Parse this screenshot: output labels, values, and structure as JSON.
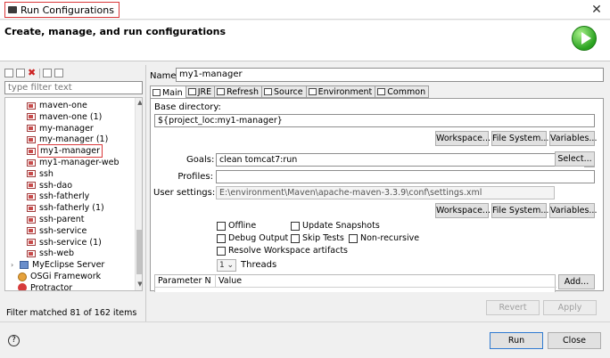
{
  "window": {
    "title": "Run Configurations",
    "close_glyph": "✕"
  },
  "header": {
    "text": "Create, manage, and run configurations",
    "icon": "run-icon"
  },
  "left": {
    "toolbar_icons": [
      "new-config-icon",
      "duplicate-icon",
      "delete-icon",
      "filter-icon",
      "collapse-icon"
    ],
    "toolbar_delete_glyph": "✖",
    "filter_placeholder": "type filter text",
    "tree": [
      {
        "label": "maven-one",
        "type": "maven"
      },
      {
        "label": "maven-one (1)",
        "type": "maven"
      },
      {
        "label": "my-manager",
        "type": "maven"
      },
      {
        "label": "my-manager (1)",
        "type": "maven"
      },
      {
        "label": "my1-manager",
        "type": "maven",
        "selected": true
      },
      {
        "label": "my1-manager-web",
        "type": "maven"
      },
      {
        "label": "ssh",
        "type": "maven"
      },
      {
        "label": "ssh-dao",
        "type": "maven"
      },
      {
        "label": "ssh-fatherly",
        "type": "maven"
      },
      {
        "label": "ssh-fatherly (1)",
        "type": "maven"
      },
      {
        "label": "ssh-parent",
        "type": "maven"
      },
      {
        "label": "ssh-service",
        "type": "maven"
      },
      {
        "label": "ssh-service (1)",
        "type": "maven"
      },
      {
        "label": "ssh-web",
        "type": "maven"
      },
      {
        "label": "MyEclipse Server",
        "type": "server",
        "twisty": "›"
      },
      {
        "label": "OSGi Framework",
        "type": "osgi"
      },
      {
        "label": "Protractor",
        "type": "protractor"
      }
    ],
    "scroll_up_glyph": "▲",
    "scroll_down_glyph": "▼",
    "status": "Filter matched 81 of 162 items"
  },
  "main": {
    "name_label": "Name:",
    "name_value": "my1-manager",
    "tabs": [
      {
        "label": "Main",
        "active": true
      },
      {
        "label": "JRE"
      },
      {
        "label": "Refresh"
      },
      {
        "label": "Source"
      },
      {
        "label": "Environment"
      },
      {
        "label": "Common"
      }
    ],
    "base_dir_label": "Base directory:",
    "base_dir_value": "${project_loc:my1-manager}",
    "buttons_row1": [
      "Workspace...",
      "File System...",
      "Variables..."
    ],
    "goals_label": "Goals:",
    "goals_value": "clean tomcat7:run",
    "select_button": "Select...",
    "profiles_label": "Profiles:",
    "profiles_value": "",
    "user_settings_label": "User settings:",
    "user_settings_value": "E:\\environment\\Maven\\apache-maven-3.3.9\\conf\\settings.xml",
    "buttons_row2": [
      "Workspace...",
      "File System...",
      "Variables..."
    ],
    "checkboxes": {
      "offline": "Offline",
      "update_snapshots": "Update Snapshots",
      "debug_output": "Debug Output",
      "skip_tests": "Skip Tests",
      "non_recursive": "Non-recursive",
      "resolve_workspace": "Resolve Workspace artifacts"
    },
    "threads_value": "1",
    "threads_dropdown_glyph": "⌄",
    "threads_label": "Threads",
    "param_headers": [
      "Parameter N",
      "Value"
    ],
    "add_button": "Add..."
  },
  "footer": {
    "revert": "Revert",
    "apply": "Apply",
    "run": "Run",
    "close": "Close",
    "help_glyph": "?"
  }
}
